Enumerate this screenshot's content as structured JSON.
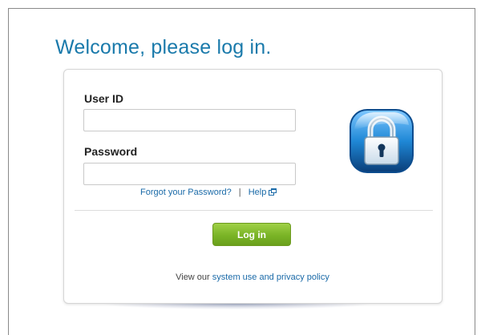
{
  "heading": "Welcome, please log in.",
  "form": {
    "user_id_label": "User ID",
    "user_id_value": "",
    "password_label": "Password",
    "password_value": ""
  },
  "links": {
    "forgot_password": "Forgot your Password?",
    "separator": "|",
    "help": "Help"
  },
  "login_button": "Log in",
  "policy": {
    "prefix": "View our ",
    "link": "system use and privacy policy"
  },
  "icons": {
    "lock": "lock-icon",
    "external_window": "external-window-icon"
  },
  "colors": {
    "heading": "#1a7aab",
    "link": "#1a6aa8",
    "button": "#7ab426",
    "lock_blue": "#1f88d6"
  }
}
